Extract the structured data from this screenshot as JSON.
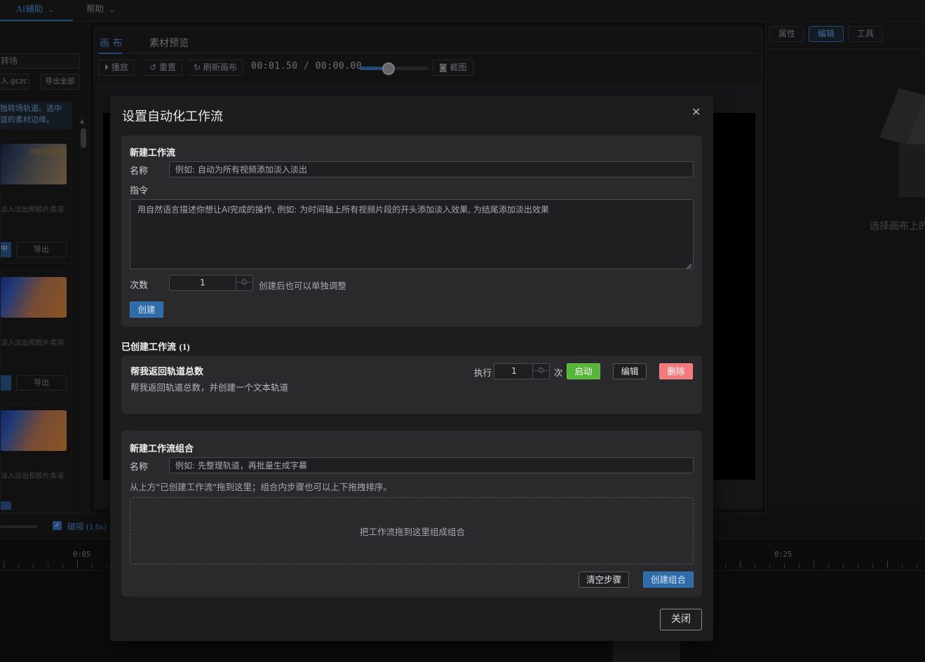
{
  "menubar": {
    "items": [
      {
        "label": "AI辅助"
      },
      {
        "label": "帮助"
      }
    ]
  },
  "left_panel": {
    "search_value": "转场",
    "import_label": "入.gczc",
    "export_all_label": "导出全部",
    "tip_lines": [
      "独转场轨道。选中",
      "道的素材边缘。"
    ],
    "cards": [
      {
        "badge": "功能开发中",
        "desc": "淡入淡出和胶片类溶",
        "export_label": "导出",
        "select_label": "中"
      },
      {
        "desc": "淡入淡出和胶片类溶",
        "export_label": "导出"
      },
      {
        "desc": "淡入淡出和胶片类溶"
      }
    ]
  },
  "center_panel": {
    "tabs": [
      {
        "label": "画 布"
      },
      {
        "label": "素材预览"
      }
    ],
    "toolbar": {
      "play_label": "播放",
      "reset_label": "重置",
      "refresh_label": "刷新画布",
      "time_display": "00:01.50 / 00:00.00",
      "screenshot_label": "截图"
    }
  },
  "right_panel": {
    "tabs": [
      {
        "label": "属性"
      },
      {
        "label": "编辑"
      },
      {
        "label": "工具"
      }
    ],
    "empty_hint": "选择画布上的"
  },
  "timeline": {
    "snap_label": "磁吸 (1.0x)",
    "ruler_labels": [
      "0:05",
      "0:25"
    ]
  },
  "modal": {
    "title": "设置自动化工作流",
    "close_label": "关闭",
    "new_workflow": {
      "section_title": "新建工作流",
      "name_label": "名称",
      "name_placeholder": "例如: 自动为所有视频添加淡入淡出",
      "instruction_label": "指令",
      "instruction_placeholder": "用自然语言描述你想让AI完成的操作, 例如: 为时间轴上所有视频片段的开头添加淡入效果, 为结尾添加淡出效果",
      "count_label": "次数",
      "count_value": "1",
      "count_hint": "创建后也可以单独调整",
      "create_label": "创建"
    },
    "created": {
      "heading": "已创建工作流",
      "count_text": "(1)",
      "items": [
        {
          "name": "帮我返回轨道总数",
          "description": "帮我返回轨道总数，并创建一个文本轨道",
          "exec_label": "执行",
          "exec_value": "1",
          "times_label": "次",
          "start_label": "启动",
          "edit_label": "编辑",
          "delete_label": "删除"
        }
      ]
    },
    "group": {
      "section_title": "新建工作流组合",
      "name_label": "名称",
      "name_placeholder": "例如: 先整理轨道，再批量生成字幕",
      "help_text": "从上方\"已创建工作流\"拖到这里；组合内步骤也可以上下拖拽排序。",
      "dropzone_text": "把工作流拖到这里组成组合",
      "clear_label": "清空步骤",
      "create_label": "创建组合"
    }
  }
}
